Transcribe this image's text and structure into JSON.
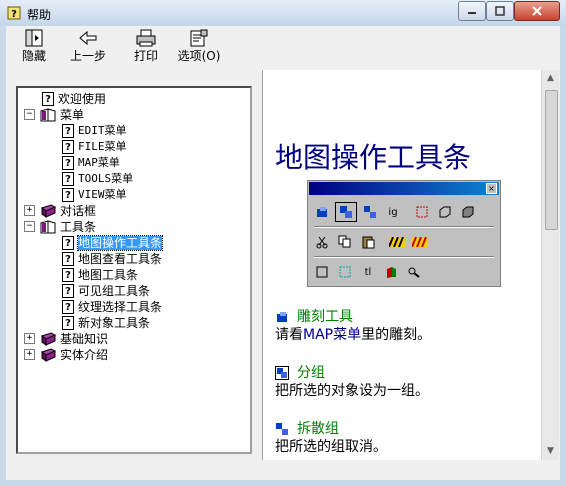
{
  "window": {
    "title": "帮助",
    "colors": {
      "title_text": "#000000",
      "heading": "#000080",
      "section_title": "#008000",
      "selection": "#3399ff"
    }
  },
  "toolbar": {
    "buttons": [
      {
        "label": "隐藏",
        "icon": "hide-icon"
      },
      {
        "label": "上一步",
        "icon": "back-arrow-icon"
      },
      {
        "label": "打印",
        "icon": "printer-icon"
      },
      {
        "label": "选项(O)",
        "icon": "options-icon"
      }
    ]
  },
  "tree": {
    "items": [
      {
        "label": "欢迎使用",
        "icon": "help-page-icon",
        "level": 1,
        "expander": ""
      },
      {
        "label": "菜单",
        "icon": "open-book-icon",
        "level": 0,
        "expander": "−"
      },
      {
        "label": "EDIT菜单",
        "icon": "help-page-icon",
        "level": 2,
        "expander": ""
      },
      {
        "label": "FILE菜单",
        "icon": "help-page-icon",
        "level": 2,
        "expander": ""
      },
      {
        "label": "MAP菜单",
        "icon": "help-page-icon",
        "level": 2,
        "expander": ""
      },
      {
        "label": "TOOLS菜单",
        "icon": "help-page-icon",
        "level": 2,
        "expander": ""
      },
      {
        "label": "VIEW菜单",
        "icon": "help-page-icon",
        "level": 2,
        "expander": ""
      },
      {
        "label": "对话框",
        "icon": "closed-book-icon",
        "level": 0,
        "expander": "+"
      },
      {
        "label": "工具条",
        "icon": "open-book-icon",
        "level": 0,
        "expander": "−"
      },
      {
        "label": "地图操作工具条",
        "icon": "help-page-icon",
        "level": 2,
        "expander": "",
        "selected": true
      },
      {
        "label": "地图查看工具条",
        "icon": "help-page-icon",
        "level": 2,
        "expander": ""
      },
      {
        "label": "地图工具条",
        "icon": "help-page-icon",
        "level": 2,
        "expander": ""
      },
      {
        "label": "可见组工具条",
        "icon": "help-page-icon",
        "level": 2,
        "expander": ""
      },
      {
        "label": "纹理选择工具条",
        "icon": "help-page-icon",
        "level": 2,
        "expander": ""
      },
      {
        "label": "新对象工具条",
        "icon": "help-page-icon",
        "level": 2,
        "expander": ""
      },
      {
        "label": "基础知识",
        "icon": "closed-book-icon",
        "level": 0,
        "expander": "+"
      },
      {
        "label": "实体介绍",
        "icon": "closed-book-icon",
        "level": 0,
        "expander": "+"
      }
    ]
  },
  "content": {
    "heading": "地图操作工具条",
    "sections": [
      {
        "title": "雕刻工具",
        "body_prefix": "请看",
        "body_link": "MAP菜单",
        "body_suffix": "里的雕刻。",
        "icon": "carve-icon"
      },
      {
        "title": "分组",
        "body": "把所选的对象设为一组。",
        "icon": "group-icon"
      },
      {
        "title": "拆散组",
        "body": "把所选的组取消。",
        "icon": "ungroup-icon"
      }
    ],
    "toolbar_image_labels": [
      "ig",
      "tl"
    ]
  }
}
